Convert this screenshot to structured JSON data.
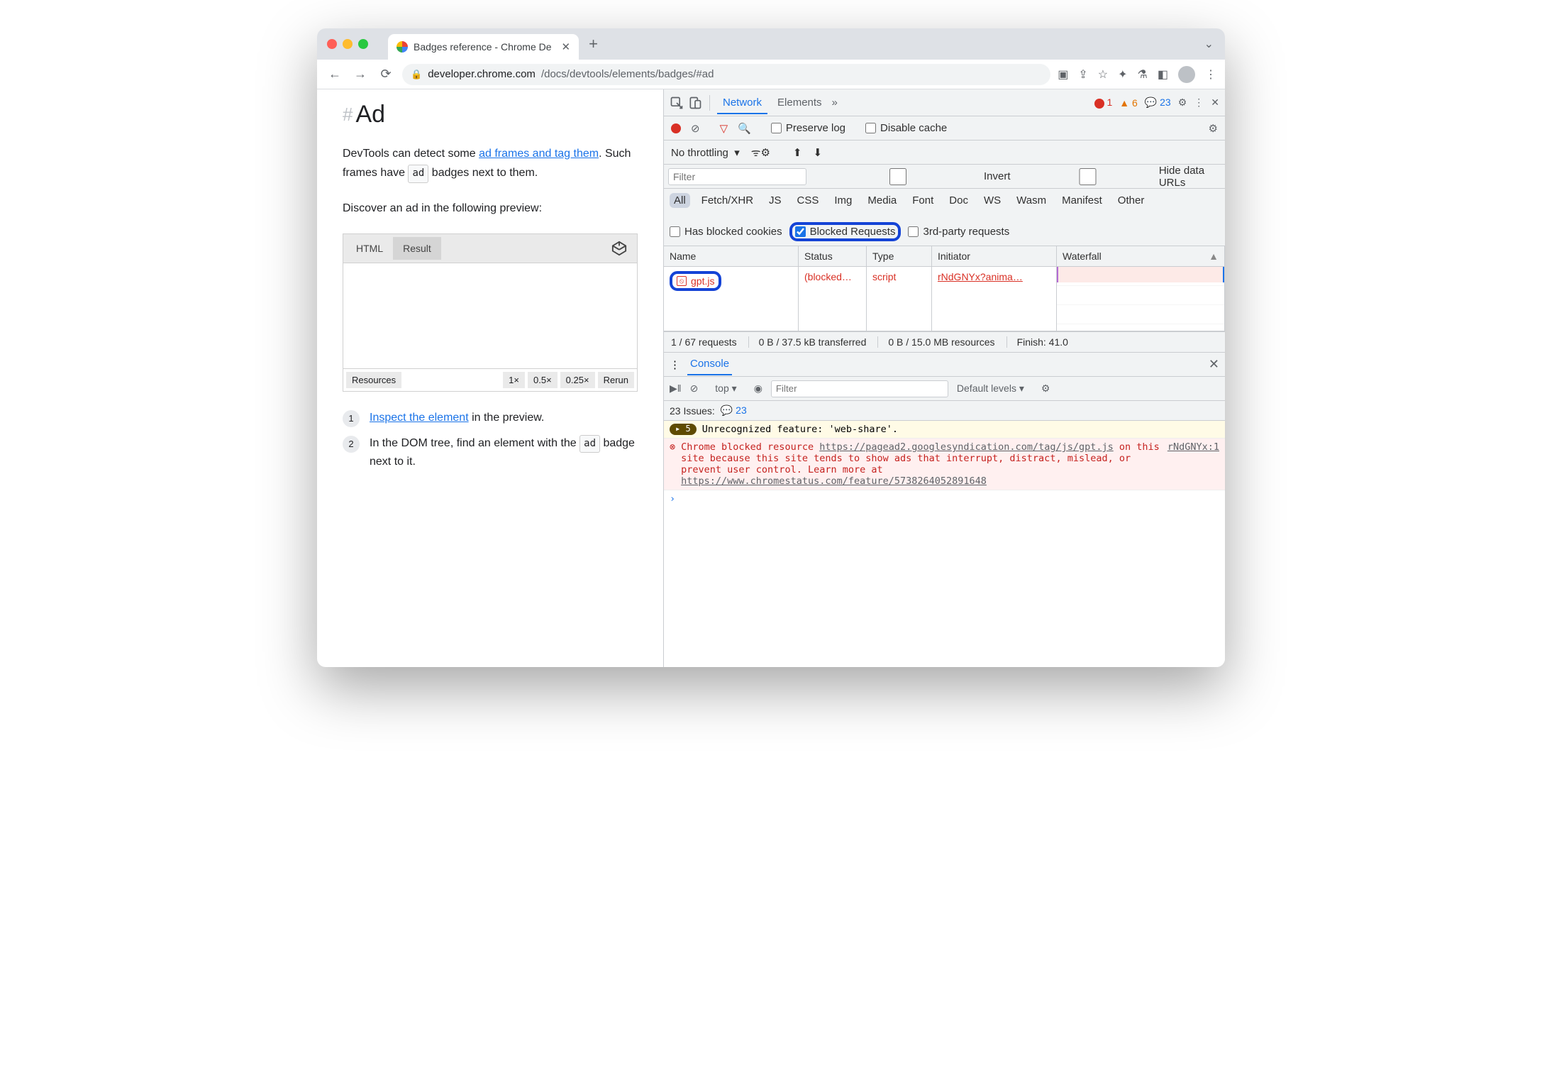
{
  "browser": {
    "tab_title": "Badges reference - Chrome De",
    "url_domain": "developer.chrome.com",
    "url_path": "/docs/devtools/elements/badges/#ad"
  },
  "page": {
    "heading": "Ad",
    "p1_a": "DevTools can detect some ",
    "p1_link": "ad frames and tag them",
    "p1_b": ". Such frames have ",
    "p1_badge": "ad",
    "p1_c": " badges next to them.",
    "p2": "Discover an ad in the following preview:",
    "preview": {
      "tab_html": "HTML",
      "tab_result": "Result",
      "foot_resources": "Resources",
      "foot_1x": "1×",
      "foot_05x": "0.5×",
      "foot_025x": "0.25×",
      "foot_rerun": "Rerun"
    },
    "step1_link": "Inspect the element",
    "step1_rest": " in the preview.",
    "step2_a": "In the DOM tree, find an element with the ",
    "step2_badge": "ad",
    "step2_b": " badge next to it."
  },
  "devtools": {
    "tab_network": "Network",
    "tab_elements": "Elements",
    "errors": "1",
    "warnings": "6",
    "messages": "23",
    "preserve_log": "Preserve log",
    "disable_cache": "Disable cache",
    "throttling": "No throttling",
    "filter_placeholder": "Filter",
    "invert": "Invert",
    "hide_urls": "Hide data URLs",
    "types": {
      "all": "All",
      "fetch": "Fetch/XHR",
      "js": "JS",
      "css": "CSS",
      "img": "Img",
      "media": "Media",
      "font": "Font",
      "doc": "Doc",
      "ws": "WS",
      "wasm": "Wasm",
      "manifest": "Manifest",
      "other": "Other"
    },
    "has_blocked_cookies": "Has blocked cookies",
    "blocked_requests": "Blocked Requests",
    "third_party": "3rd-party requests",
    "cols": {
      "name": "Name",
      "status": "Status",
      "type": "Type",
      "initiator": "Initiator",
      "waterfall": "Waterfall"
    },
    "row": {
      "name": "gpt.js",
      "status": "(blocked…",
      "type": "script",
      "initiator": "rNdGNYx?anima…"
    },
    "summary": {
      "requests": "1 / 67 requests",
      "transferred": "0 B / 37.5 kB transferred",
      "resources": "0 B / 15.0 MB resources",
      "finish": "Finish: 41.0"
    },
    "console": {
      "label": "Console",
      "context": "top",
      "filter_placeholder": "Filter",
      "levels": "Default levels",
      "issues_label": "23 Issues:",
      "issues_count": "23",
      "warn_count": "5",
      "warn_text": "Unrecognized feature: 'web-share'.",
      "err_prefix": "Chrome blocked resource ",
      "err_url1": "https://pagead2.googlesyndication.com/tag/js/gpt.js",
      "err_mid": " on this site because this site tends to show ads that interrupt, distract, mislead, or prevent user control. Learn more at ",
      "err_url2": "https://www.chromestatus.com/feature/5738264052891648",
      "err_src": "rNdGNYx:1"
    }
  }
}
